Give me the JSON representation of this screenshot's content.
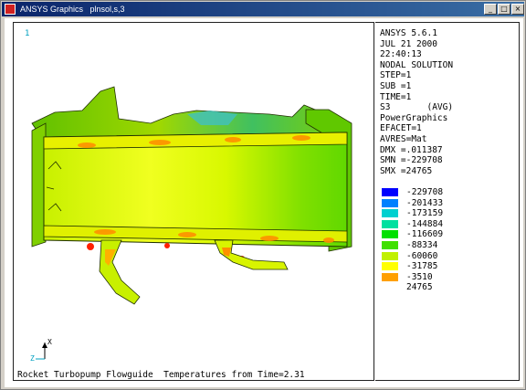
{
  "window": {
    "title": "ANSYS Graphics   plnsol,s,3"
  },
  "viewport": {
    "number": "1"
  },
  "info": {
    "lines": [
      "ANSYS 5.6.1",
      "JUL 21 2000",
      "22:40:13",
      "NODAL SOLUTION",
      "STEP=1",
      "SUB =1",
      "TIME=1",
      "S3       (AVG)",
      "PowerGraphics",
      "EFACET=1",
      "AVRES=Mat",
      "DMX =.011387",
      "SMN =-229708",
      "SMX =24765"
    ]
  },
  "legend": {
    "entries": [
      {
        "label": "-229708",
        "color": "#0000ff"
      },
      {
        "label": "-201433",
        "color": "#0080ff"
      },
      {
        "label": "-173159",
        "color": "#00d0d0"
      },
      {
        "label": "-144884",
        "color": "#00e0a0"
      },
      {
        "label": "-116609",
        "color": "#00e000"
      },
      {
        "label": "-88334",
        "color": "#40e000"
      },
      {
        "label": "-60060",
        "color": "#c0f000"
      },
      {
        "label": "-31785",
        "color": "#ffff00"
      },
      {
        "label": "-3510",
        "color": "#ffa000"
      },
      {
        "label": "24765",
        "color": "#ff0000"
      }
    ]
  },
  "triad": {
    "x_label": "X",
    "z_label": "Z"
  },
  "caption": "Rocket Turbopump Flowguide  Temperatures from Time=2.31"
}
